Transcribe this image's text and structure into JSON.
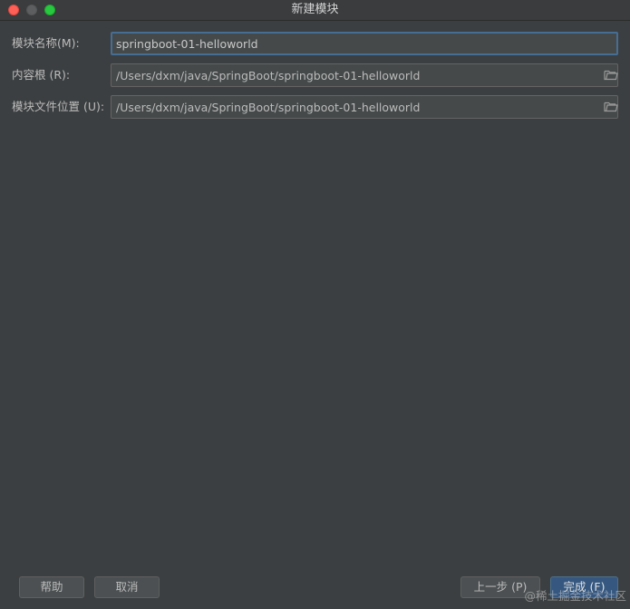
{
  "window": {
    "title": "新建模块"
  },
  "form": {
    "module_name": {
      "label": "模块名称(M):",
      "value": "springboot-01-helloworld"
    },
    "content_root": {
      "label": "内容根 (R):",
      "value": "/Users/dxm/java/SpringBoot/springboot-01-helloworld",
      "icon": "folder-icon"
    },
    "module_file_location": {
      "label": "模块文件位置 (U):",
      "value": "/Users/dxm/java/SpringBoot/springboot-01-helloworld",
      "icon": "folder-icon"
    }
  },
  "buttons": {
    "help": "帮助",
    "cancel": "取消",
    "previous": "上一步 (P)",
    "finish": "完成 (F)"
  },
  "watermark": "@稀土掘金技术社区",
  "colors": {
    "background": "#3c3f41",
    "field_bg": "#45494a",
    "focus_border": "#466d94",
    "primary_button": "#365880",
    "close": "#fe5f57",
    "maximize": "#28c840"
  }
}
